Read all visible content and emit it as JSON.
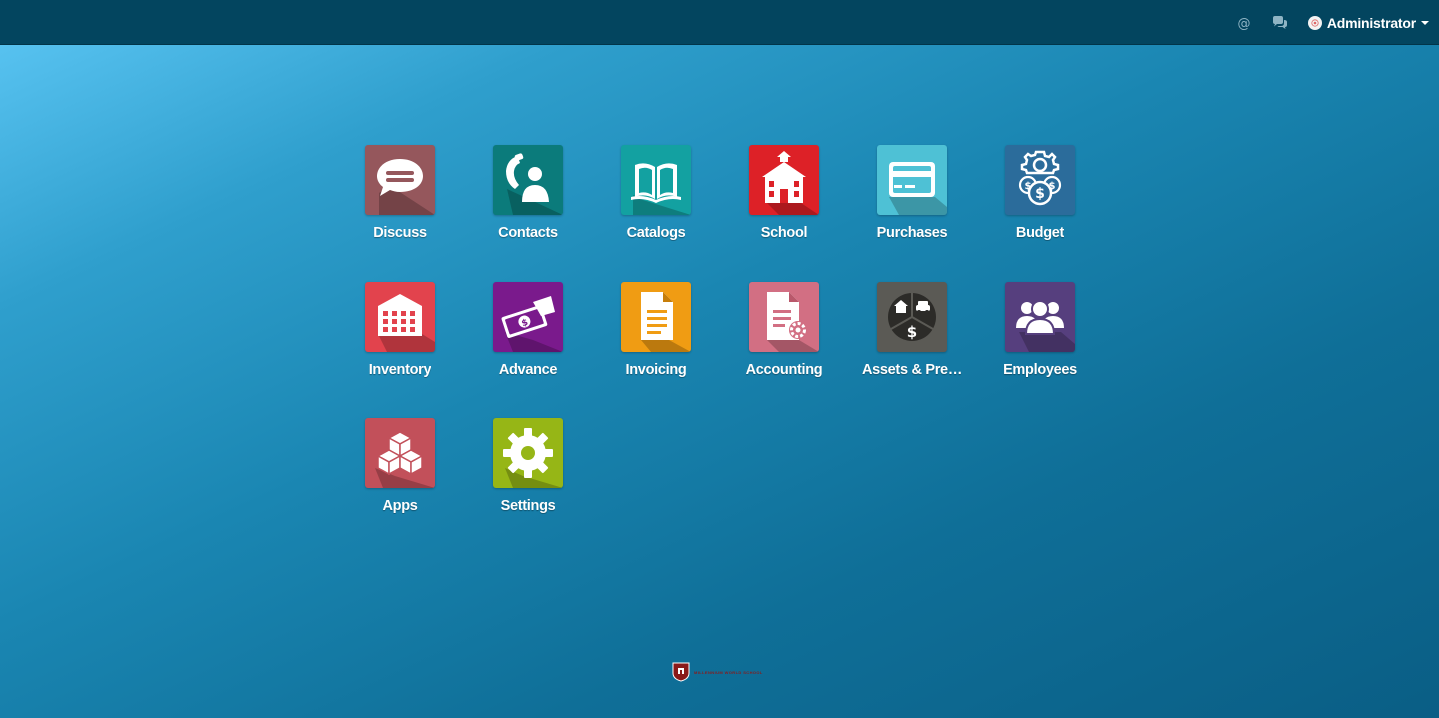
{
  "topbar": {
    "user_name": "Administrator",
    "icons": [
      "at-icon",
      "chat-icon",
      "avatar-icon",
      "caret-down-icon"
    ]
  },
  "apps": [
    {
      "label": "Discuss",
      "icon": "discuss-icon",
      "color": "#95575c",
      "row": 0,
      "col": 0
    },
    {
      "label": "Contacts",
      "icon": "contacts-icon",
      "color": "#0b7b7b",
      "row": 0,
      "col": 1
    },
    {
      "label": "Catalogs",
      "icon": "catalogs-icon",
      "color": "#13a1a1",
      "row": 0,
      "col": 2
    },
    {
      "label": "School",
      "icon": "school-icon",
      "color": "#dd2127",
      "row": 0,
      "col": 3
    },
    {
      "label": "Purchases",
      "icon": "purchases-icon",
      "color": "#4ec1d5",
      "row": 0,
      "col": 4
    },
    {
      "label": "Budget",
      "icon": "budget-icon",
      "color": "#2b6c9b",
      "row": 0,
      "col": 5
    },
    {
      "label": "Inventory",
      "icon": "inventory-icon",
      "color": "#e2434d",
      "row": 1,
      "col": 0
    },
    {
      "label": "Advance",
      "icon": "advance-icon",
      "color": "#7a1a8c",
      "row": 1,
      "col": 1
    },
    {
      "label": "Invoicing",
      "icon": "invoicing-icon",
      "color": "#f09c13",
      "row": 1,
      "col": 2
    },
    {
      "label": "Accounting",
      "icon": "accounting-icon",
      "color": "#d26f83",
      "row": 1,
      "col": 3
    },
    {
      "label": "Assets & Pre…",
      "icon": "assets-icon",
      "color": "#5b5a55",
      "row": 1,
      "col": 4
    },
    {
      "label": "Employees",
      "icon": "employees-icon",
      "color": "#563f7e",
      "row": 1,
      "col": 5
    },
    {
      "label": "Apps",
      "icon": "apps-icon",
      "color": "#c2505a",
      "row": 2,
      "col": 0
    },
    {
      "label": "Settings",
      "icon": "settings-icon",
      "color": "#96b616",
      "row": 2,
      "col": 1
    }
  ],
  "footer": {
    "logo_text": "Millennium World School"
  }
}
